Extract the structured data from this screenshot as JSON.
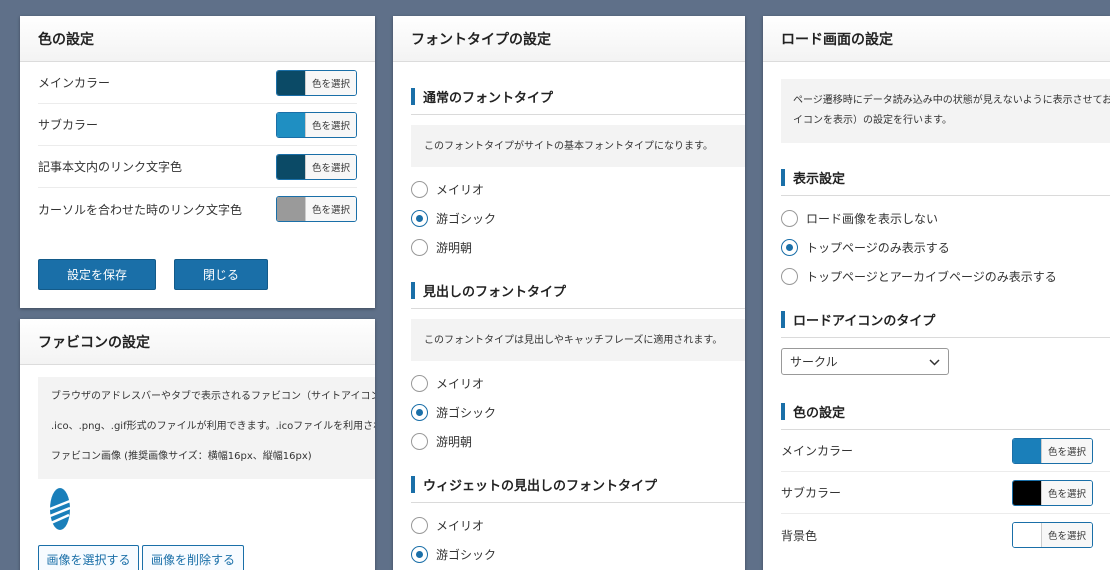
{
  "color_panel": {
    "title": "色の設定",
    "rows": [
      {
        "label": "メインカラー",
        "swatch": "#0b4a66",
        "button": "色を選択"
      },
      {
        "label": "サブカラー",
        "swatch": "#1f8fc2",
        "button": "色を選択"
      },
      {
        "label": "記事本文内のリンク文字色",
        "swatch": "#0b4a66",
        "button": "色を選択"
      },
      {
        "label": "カーソルを合わせた時のリンク文字色",
        "swatch": "#9a9a9a",
        "button": "色を選択"
      }
    ],
    "save_label": "設定を保存",
    "close_label": "閉じる"
  },
  "favicon_panel": {
    "title": "ファビコンの設定",
    "info_line1": "ブラウザのアドレスバーやタブで表示されるファビコン（サイトアイコン",
    "info_line2": ".ico、.png、.gif形式のファイルが利用できます。.icoファイルを利用され",
    "info_line3": "ファビコン画像 (推奨画像サイズ：横幅16px、縦幅16px)",
    "select_label": "画像を選択する",
    "delete_label": "画像を削除する"
  },
  "font_panel": {
    "title": "フォントタイプの設定",
    "normal": {
      "title": "通常のフォントタイプ",
      "info": "このフォントタイプがサイトの基本フォントタイプになります。",
      "options": [
        "メイリオ",
        "游ゴシック",
        "游明朝"
      ],
      "selected": 1
    },
    "heading": {
      "title": "見出しのフォントタイプ",
      "info": "このフォントタイプは見出しやキャッチフレーズに適用されます。",
      "options": [
        "メイリオ",
        "游ゴシック",
        "游明朝"
      ],
      "selected": 1
    },
    "widget": {
      "title": "ウィジェットの見出しのフォントタイプ",
      "options": [
        "メイリオ",
        "游ゴシック"
      ],
      "selected": 1
    }
  },
  "load_panel": {
    "title": "ロード画面の設定",
    "info_line1": "ページ遷移時にデータ読み込み中の状態が見えないように表示させてお",
    "info_line2": "イコンを表示）の設定を行います。",
    "display_title": "表示設定",
    "display_options": [
      "ロード画像を表示しない",
      "トップページのみ表示する",
      "トップページとアーカイブページのみ表示する"
    ],
    "display_selected": 1,
    "icon_type_title": "ロードアイコンのタイプ",
    "icon_type_value": "サークル",
    "color_title": "色の設定",
    "color_rows": [
      {
        "label": "メインカラー",
        "swatch": "#1a7fba",
        "button": "色を選択"
      },
      {
        "label": "サブカラー",
        "swatch": "#000000",
        "button": "色を選択"
      },
      {
        "label": "背景色",
        "swatch": "#ffffff",
        "button": "色を選択"
      }
    ]
  },
  "colors": {
    "accent": "#1a6fa8",
    "background": "#5f7089",
    "favicon_blue": "#1a7fba"
  }
}
